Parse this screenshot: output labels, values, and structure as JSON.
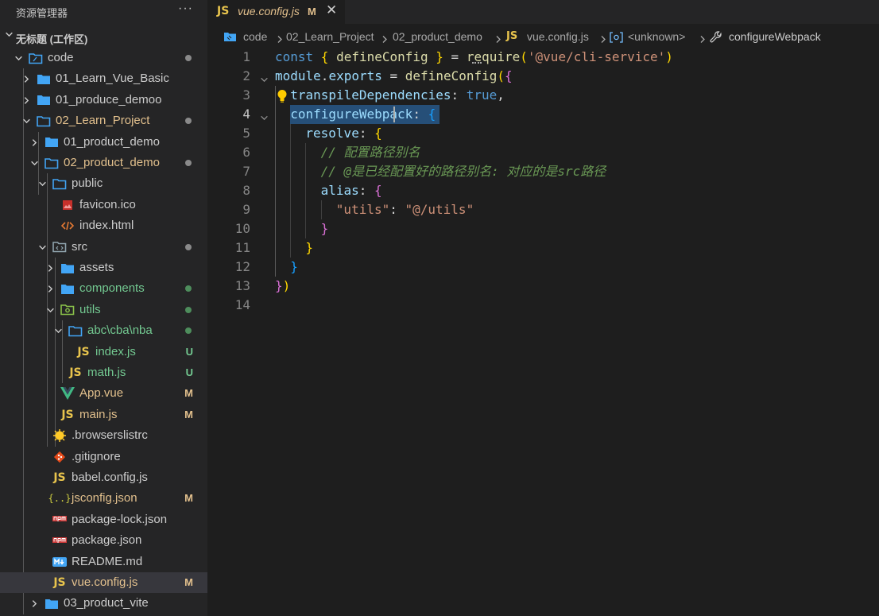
{
  "explorer": {
    "title": "资源管理器",
    "more": "···",
    "workspace": "无标题 (工作区)"
  },
  "tree": [
    {
      "label": "code",
      "kind": "folder-root",
      "indent": 0,
      "chevron": "down",
      "status": "dot-grey"
    },
    {
      "label": "01_Learn_Vue_Basic",
      "kind": "folder",
      "indent": 1,
      "chevron": "right"
    },
    {
      "label": "01_produce_demoo",
      "kind": "folder",
      "indent": 1,
      "chevron": "right"
    },
    {
      "label": "02_Learn_Project",
      "kind": "folder-open",
      "indent": 1,
      "chevron": "down",
      "status": "dot-grey",
      "color": "#e2c08d"
    },
    {
      "label": "01_product_demo",
      "kind": "folder",
      "indent": 2,
      "chevron": "right"
    },
    {
      "label": "02_product_demo",
      "kind": "folder-open",
      "indent": 2,
      "chevron": "down",
      "status": "dot-grey",
      "color": "#e2c08d"
    },
    {
      "label": "public",
      "kind": "folder-open",
      "indent": 3,
      "chevron": "down"
    },
    {
      "label": "favicon.ico",
      "kind": "image",
      "indent": 4
    },
    {
      "label": "index.html",
      "kind": "html",
      "indent": 4
    },
    {
      "label": "src",
      "kind": "folder-src",
      "indent": 3,
      "chevron": "down",
      "status": "dot-grey"
    },
    {
      "label": "assets",
      "kind": "folder",
      "indent": 4,
      "chevron": "right"
    },
    {
      "label": "components",
      "kind": "folder",
      "indent": 4,
      "chevron": "right",
      "status": "dot-green",
      "color": "#73c991"
    },
    {
      "label": "utils",
      "kind": "folder-utils",
      "indent": 4,
      "chevron": "down",
      "status": "dot-green",
      "color": "#73c991"
    },
    {
      "label": "abc\\cba\\nba",
      "kind": "folder-open",
      "indent": 5,
      "chevron": "down",
      "status": "dot-green",
      "color": "#73c991"
    },
    {
      "label": "index.js",
      "kind": "js",
      "indent": 6,
      "badge": "U",
      "color": "#73c991"
    },
    {
      "label": "math.js",
      "kind": "js",
      "indent": 5,
      "badge": "U",
      "color": "#73c991"
    },
    {
      "label": "App.vue",
      "kind": "vue",
      "indent": 4,
      "badge": "M",
      "color": "#e2c08d"
    },
    {
      "label": "main.js",
      "kind": "js",
      "indent": 4,
      "badge": "M",
      "color": "#e2c08d"
    },
    {
      "label": ".browserslistrc",
      "kind": "browserslist",
      "indent": 3
    },
    {
      "label": ".gitignore",
      "kind": "git",
      "indent": 3
    },
    {
      "label": "babel.config.js",
      "kind": "js",
      "indent": 3
    },
    {
      "label": "jsconfig.json",
      "kind": "json",
      "indent": 3,
      "badge": "M",
      "color": "#e2c08d"
    },
    {
      "label": "package-lock.json",
      "kind": "npm",
      "indent": 3
    },
    {
      "label": "package.json",
      "kind": "npm",
      "indent": 3
    },
    {
      "label": "README.md",
      "kind": "md",
      "indent": 3
    },
    {
      "label": "vue.config.js",
      "kind": "js",
      "indent": 3,
      "badge": "M",
      "color": "#e2c08d",
      "selected": true
    },
    {
      "label": "03_product_vite",
      "kind": "folder",
      "indent": 2,
      "chevron": "right"
    }
  ],
  "tab": {
    "icon": "JS",
    "filename": "vue.config.js",
    "badge": "M",
    "close": "✕"
  },
  "breadcrumb": {
    "items": [
      "code",
      "02_Learn_Project",
      "02_product_demo",
      "vue.config.js",
      "<unknown>",
      "configureWebpack"
    ],
    "js_icon": "JS"
  },
  "code_lines": [
    {
      "n": "1",
      "tokens": [
        [
          "k",
          "const "
        ],
        [
          "b1",
          "{ "
        ],
        [
          "f",
          "defineConfig"
        ],
        [
          "b1",
          " }"
        ],
        [
          "p",
          " = "
        ],
        [
          "f",
          "require"
        ],
        [
          "b1",
          "("
        ],
        [
          "s",
          "'@vue/cli-service'"
        ],
        [
          "b1",
          ")"
        ]
      ]
    },
    {
      "n": "2",
      "tokens": [
        [
          "v",
          "module"
        ],
        [
          "p",
          "."
        ],
        [
          "v",
          "exports"
        ],
        [
          "p",
          " = "
        ],
        [
          "f",
          "defineConfig"
        ],
        [
          "b1",
          "("
        ],
        [
          "b2",
          "{"
        ]
      ]
    },
    {
      "n": "3",
      "tokens": [
        [
          "v",
          "transpileDependencies"
        ],
        [
          "p",
          ": "
        ],
        [
          "k",
          "true"
        ],
        [
          "p",
          ","
        ]
      ]
    },
    {
      "n": "4",
      "tokens": [
        [
          "v",
          "configureWebpack"
        ],
        [
          "p",
          ": "
        ],
        [
          "b3",
          "{"
        ]
      ]
    },
    {
      "n": "5",
      "tokens": [
        [
          "v",
          "resolve"
        ],
        [
          "p",
          ": "
        ],
        [
          "b1",
          "{"
        ]
      ]
    },
    {
      "n": "6",
      "tokens": [
        [
          "c",
          "// 配置路径别名"
        ]
      ]
    },
    {
      "n": "7",
      "tokens": [
        [
          "c",
          "// @是已经配置好的路径别名: 对应的是src路径"
        ]
      ]
    },
    {
      "n": "8",
      "tokens": [
        [
          "v",
          "alias"
        ],
        [
          "p",
          ": "
        ],
        [
          "b2",
          "{"
        ]
      ]
    },
    {
      "n": "9",
      "tokens": [
        [
          "s",
          "\"utils\""
        ],
        [
          "p",
          ": "
        ],
        [
          "s",
          "\"@/utils\""
        ]
      ]
    },
    {
      "n": "10",
      "tokens": [
        [
          "b2",
          "}"
        ]
      ]
    },
    {
      "n": "11",
      "tokens": [
        [
          "b1",
          "}"
        ]
      ]
    },
    {
      "n": "12",
      "tokens": [
        [
          "b3",
          "}"
        ]
      ]
    },
    {
      "n": "13",
      "tokens": [
        [
          "b2",
          "}"
        ],
        [
          "b1",
          ")"
        ]
      ]
    },
    {
      "n": "14",
      "tokens": []
    }
  ],
  "colors": {
    "accent": "#007acc",
    "folder": "#42a5f5",
    "modified": "#e2c08d",
    "untracked": "#73c991"
  }
}
